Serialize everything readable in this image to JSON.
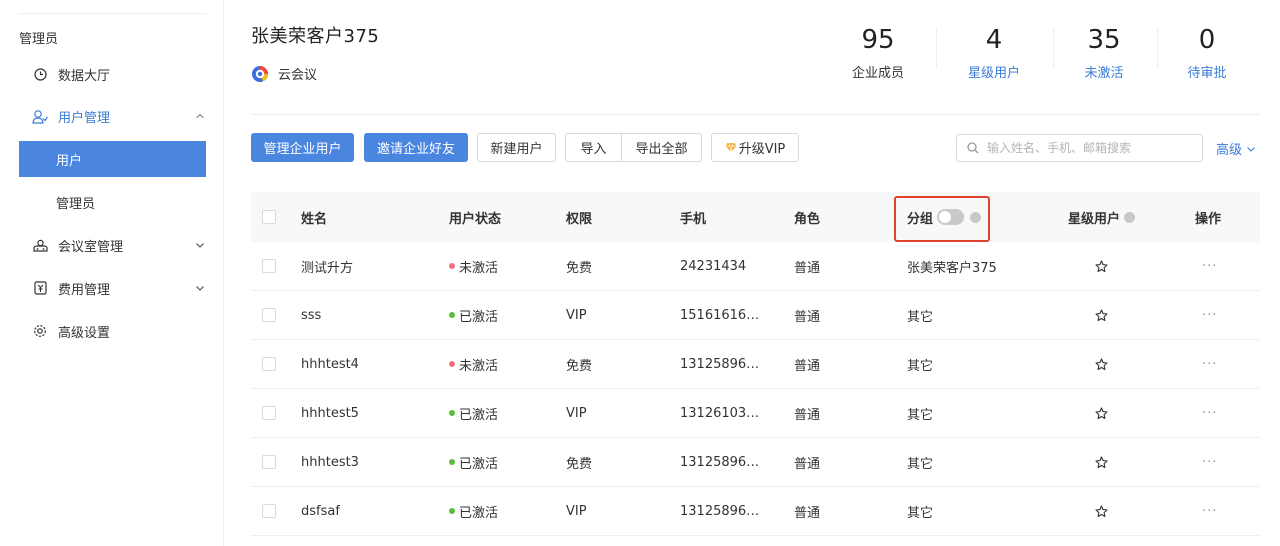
{
  "sidebar": {
    "section_title": "管理员",
    "items": [
      {
        "label": "数据大厅"
      },
      {
        "label": "用户管理"
      },
      {
        "label": "用户"
      },
      {
        "label": "管理员"
      },
      {
        "label": "会议室管理"
      },
      {
        "label": "费用管理"
      },
      {
        "label": "高级设置"
      }
    ]
  },
  "header": {
    "title": "张美荣客户375",
    "subtitle": "云会议",
    "stats": [
      {
        "value": "95",
        "label": "企业成员"
      },
      {
        "value": "4",
        "label": "星级用户"
      },
      {
        "value": "35",
        "label": "未激活"
      },
      {
        "value": "0",
        "label": "待审批"
      }
    ]
  },
  "toolbar": {
    "manage_users": "管理企业用户",
    "invite_friends": "邀请企业好友",
    "new_user": "新建用户",
    "import": "导入",
    "export_all": "导出全部",
    "upgrade_vip": "升级VIP",
    "search_placeholder": "输入姓名、手机、邮箱搜索",
    "advanced": "高级"
  },
  "table": {
    "columns": {
      "name": "姓名",
      "status": "用户状态",
      "permission": "权限",
      "phone": "手机",
      "role": "角色",
      "group": "分组",
      "star": "星级用户",
      "action": "操作"
    },
    "rows": [
      {
        "name": "测试升方",
        "status": "未激活",
        "status_color": "#f0717b",
        "permission": "免费",
        "phone": "24231434",
        "role": "普通",
        "group": "张美荣客户375",
        "more": "···"
      },
      {
        "name": "sss",
        "status": "已激活",
        "status_color": "#5cbd3b",
        "permission": "VIP",
        "phone": "15161616…",
        "role": "普通",
        "group": "其它",
        "more": "···"
      },
      {
        "name": "hhhtest4",
        "status": "未激活",
        "status_color": "#f0717b",
        "permission": "免费",
        "phone": "13125896…",
        "role": "普通",
        "group": "其它",
        "more": "···"
      },
      {
        "name": "hhhtest5",
        "status": "已激活",
        "status_color": "#5cbd3b",
        "permission": "VIP",
        "phone": "13126103…",
        "role": "普通",
        "group": "其它",
        "more": "···"
      },
      {
        "name": "hhhtest3",
        "status": "已激活",
        "status_color": "#5cbd3b",
        "permission": "免费",
        "phone": "13125896…",
        "role": "普通",
        "group": "其它",
        "more": "···"
      },
      {
        "name": "dsfsaf",
        "status": "已激活",
        "status_color": "#5cbd3b",
        "permission": "VIP",
        "phone": "13125896…",
        "role": "普通",
        "group": "其它",
        "more": "···"
      }
    ]
  },
  "colors": {
    "accent": "#4a86e0",
    "link": "#3a7bd5",
    "highlight": "#e0432f"
  }
}
